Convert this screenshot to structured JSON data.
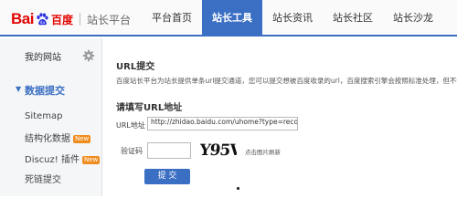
{
  "header": {
    "logo_text_bai": "Bai",
    "logo_text_du": "百度",
    "platform_name": "站长平台",
    "nav": [
      {
        "label": "平台首页",
        "active": false
      },
      {
        "label": "站长工具",
        "active": true
      },
      {
        "label": "站长资讯",
        "active": false
      },
      {
        "label": "站长社区",
        "active": false
      },
      {
        "label": "站长沙龙",
        "active": false
      }
    ]
  },
  "sidebar": {
    "my_sites": "我的网站",
    "active_section": "数据提交",
    "items": [
      {
        "label": "Sitemap",
        "badge": ""
      },
      {
        "label": "结构化数据",
        "badge": "New"
      },
      {
        "label": "Discuz! 插件",
        "badge": "New"
      },
      {
        "label": "死链提交",
        "badge": ""
      }
    ]
  },
  "main": {
    "title": "URL提交",
    "description": "百度站长平台为站长提供单条url提交通道，您可以提交想被百度收录的url，百度搜索引擎会按照标准处理，但不保证一定",
    "subtitle": "请填写URL地址",
    "url_label": "URL地址",
    "url_value": "http://zhidao.baidu.com/uhome?type=recommend",
    "captcha_label": "验证码",
    "captcha_text": "Y95V",
    "refresh_text": "点击图片刷新",
    "submit_label": "提 交"
  },
  "colors": {
    "accent": "#3b6fc3",
    "brand_red": "#e10602",
    "badge_orange": "#f08c1e"
  },
  "icons": {
    "logo_paw": "baidu-paw-icon",
    "settings": "gear-icon",
    "active_arrow": "triangle-down-icon"
  }
}
